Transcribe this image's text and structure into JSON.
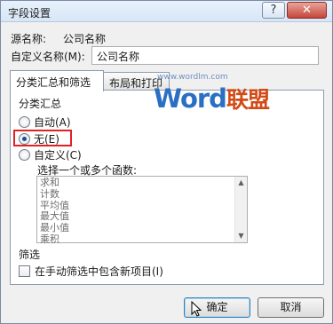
{
  "window": {
    "title": "字段设置",
    "help_glyph": "?",
    "close_glyph": "✕"
  },
  "source": {
    "label": "源名称:",
    "value": "公司名称"
  },
  "custom_name": {
    "label": "自定义名称(M):",
    "value": "公司名称"
  },
  "tabs": [
    {
      "label": "分类汇总和筛选",
      "active": true
    },
    {
      "label": "布局和打印",
      "active": false
    }
  ],
  "subtotals": {
    "heading": "分类汇总",
    "options": [
      {
        "label": "自动(A)",
        "checked": false
      },
      {
        "label": "无(E)",
        "checked": true
      },
      {
        "label": "自定义(C)",
        "checked": false
      }
    ],
    "function_label": "选择一个或多个函数:",
    "functions": [
      "求和",
      "计数",
      "平均值",
      "最大值",
      "最小值",
      "乘积"
    ]
  },
  "filter": {
    "heading": "筛选",
    "include_new_label": "在手动筛选中包含新项目(I)",
    "include_new_checked": false
  },
  "watermark": {
    "url": "www.wordlm.com",
    "brand_word": "Word",
    "brand_cn": "联盟"
  },
  "buttons": {
    "ok": "确定",
    "cancel": "取消"
  },
  "colors": {
    "highlight_box": "#e02222",
    "watermark_blue": "#2b6fc4",
    "watermark_orange": "#d14b16"
  }
}
